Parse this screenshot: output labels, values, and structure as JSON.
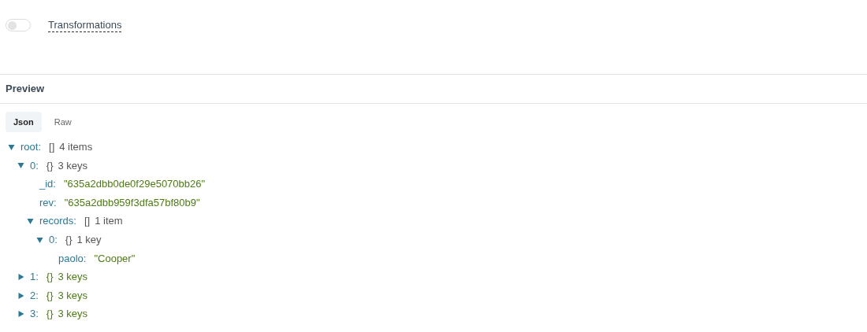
{
  "transformations": {
    "label": "Transformations",
    "on": false
  },
  "preview": {
    "title": "Preview",
    "tabs": [
      {
        "label": "Json",
        "selected": true
      },
      {
        "label": "Raw",
        "selected": false
      }
    ],
    "tree": [
      {
        "key": "root:",
        "brace": "[]",
        "summary": "4 items",
        "expanded": true,
        "children": [
          {
            "key": "0:",
            "brace": "{}",
            "summary": "3 keys",
            "expanded": true,
            "children": [
              {
                "key": "_id:",
                "value": "\"635a2dbb0de0f29e5070bb26\""
              },
              {
                "key": "rev:",
                "value": "\"635a2dbb959f3dfa57bf80b9\""
              },
              {
                "key": "records:",
                "brace": "[]",
                "summary": "1 item",
                "expanded": true,
                "children": [
                  {
                    "key": "0:",
                    "brace": "{}",
                    "summary": "1 key",
                    "expanded": true,
                    "children": [
                      {
                        "key": "paolo:",
                        "value": "\"Cooper\""
                      }
                    ]
                  }
                ]
              }
            ]
          },
          {
            "key": "1:",
            "brace": "{}",
            "summary": "3 keys",
            "expanded": false
          },
          {
            "key": "2:",
            "brace": "{}",
            "summary": "3 keys",
            "expanded": false
          },
          {
            "key": "3:",
            "brace": "{}",
            "summary": "3 keys",
            "expanded": false
          }
        ]
      }
    ]
  }
}
